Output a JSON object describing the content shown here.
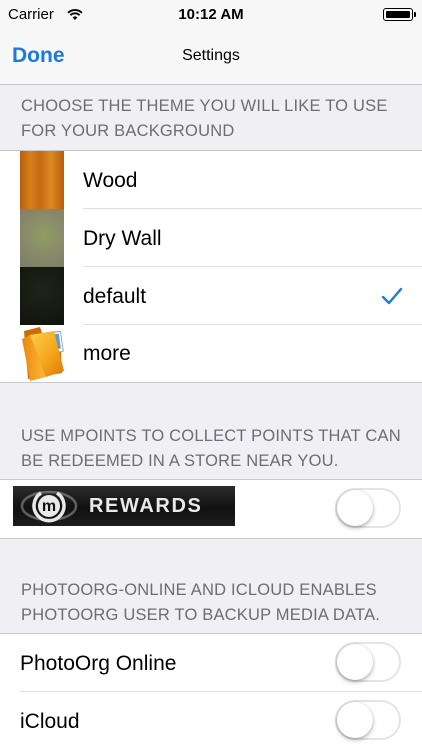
{
  "status_bar": {
    "carrier": "Carrier",
    "time": "10:12 AM",
    "wifi_icon": "wifi-icon",
    "battery_icon": "battery-icon",
    "battery_level": 1.0
  },
  "nav": {
    "done_label": "Done",
    "title": "Settings"
  },
  "theme_section": {
    "header": "CHOOSE THE THEME YOU WILL LIKE TO USE FOR YOUR BACKGROUND",
    "items": [
      {
        "label": "Wood",
        "thumbnail": "wood-texture",
        "selected": false
      },
      {
        "label": "Dry Wall",
        "thumbnail": "drywall-texture",
        "selected": false
      },
      {
        "label": "default",
        "thumbnail": "dark-texture",
        "selected": true
      },
      {
        "label": "more",
        "thumbnail": "folder-icon",
        "selected": false
      }
    ]
  },
  "mpoints_section": {
    "header": "USE MPOINTS TO COLLECT POINTS THAT CAN BE REDEEMED IN A STORE NEAR YOU.",
    "banner_logo_letter": "m",
    "banner_text": "REWARDS",
    "toggle_on": false
  },
  "backup_section": {
    "header": "PHOTOORG-ONLINE AND ICLOUD ENABLES PHOTOORG USER TO BACKUP MEDIA DATA.",
    "items": [
      {
        "label": "PhotoOrg Online",
        "toggle_on": false
      },
      {
        "label": "iCloud",
        "toggle_on": false
      }
    ]
  },
  "colors": {
    "accent": "#1b7ae0",
    "background": "#efeff4",
    "section_text": "#6d6d72"
  }
}
